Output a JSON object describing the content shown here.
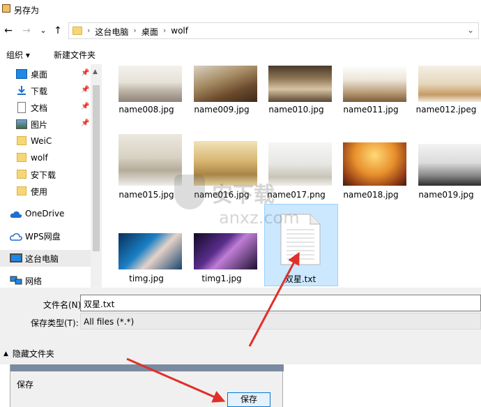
{
  "window": {
    "title": "另存为"
  },
  "nav": {
    "back": "←",
    "forward": "→",
    "dropdown": "⌄",
    "up": "↑"
  },
  "address": {
    "crumbs": [
      "这台电脑",
      "桌面",
      "wolf"
    ],
    "separator": "›",
    "dropdown": "⌄"
  },
  "toolbar": {
    "organize": "组织 ▾",
    "new_folder": "新建文件夹"
  },
  "sidebar": {
    "items": [
      {
        "label": "桌面",
        "icon": "desktop-icon"
      },
      {
        "label": "下载",
        "icon": "download-icon"
      },
      {
        "label": "文档",
        "icon": "document-icon"
      },
      {
        "label": "图片",
        "icon": "pictures-icon"
      },
      {
        "label": "WeiC",
        "icon": "folder-icon"
      },
      {
        "label": "wolf",
        "icon": "folder-icon"
      },
      {
        "label": "安下载",
        "icon": "folder-icon"
      },
      {
        "label": "使用",
        "icon": "folder-icon"
      },
      {
        "label": "OneDrive",
        "icon": "onedrive-icon"
      },
      {
        "label": "WPS网盘",
        "icon": "cloud-icon"
      },
      {
        "label": "这台电脑",
        "icon": "computer-icon"
      },
      {
        "label": "网络",
        "icon": "network-icon"
      }
    ],
    "pin": "📌"
  },
  "files": [
    {
      "name": "name008.jpg"
    },
    {
      "name": "name009.jpg"
    },
    {
      "name": "name010.jpg"
    },
    {
      "name": "name011.jpg"
    },
    {
      "name": "name012.jpeg"
    },
    {
      "name": "name015.jpg"
    },
    {
      "name": "name016.jpg"
    },
    {
      "name": "name017.png"
    },
    {
      "name": "name018.jpg"
    },
    {
      "name": "name019.jpg"
    },
    {
      "name": "timg.jpg"
    },
    {
      "name": "timg1.jpg"
    },
    {
      "name": "双星.txt"
    }
  ],
  "form": {
    "filename_label": "文件名(N):",
    "filename_value": "双星.txt",
    "filetype_label": "保存类型(T):",
    "filetype_value": "All files (*.*)",
    "hide_folders": "隐藏文件夹"
  },
  "second_dialog": {
    "title": "保存",
    "save_button": "保存"
  },
  "watermark": {
    "line1": "安下载",
    "line2": "anxz.com"
  },
  "colors": {
    "selection": "#cce8ff",
    "accent": "#0078d7",
    "arrow": "#e0302a"
  }
}
